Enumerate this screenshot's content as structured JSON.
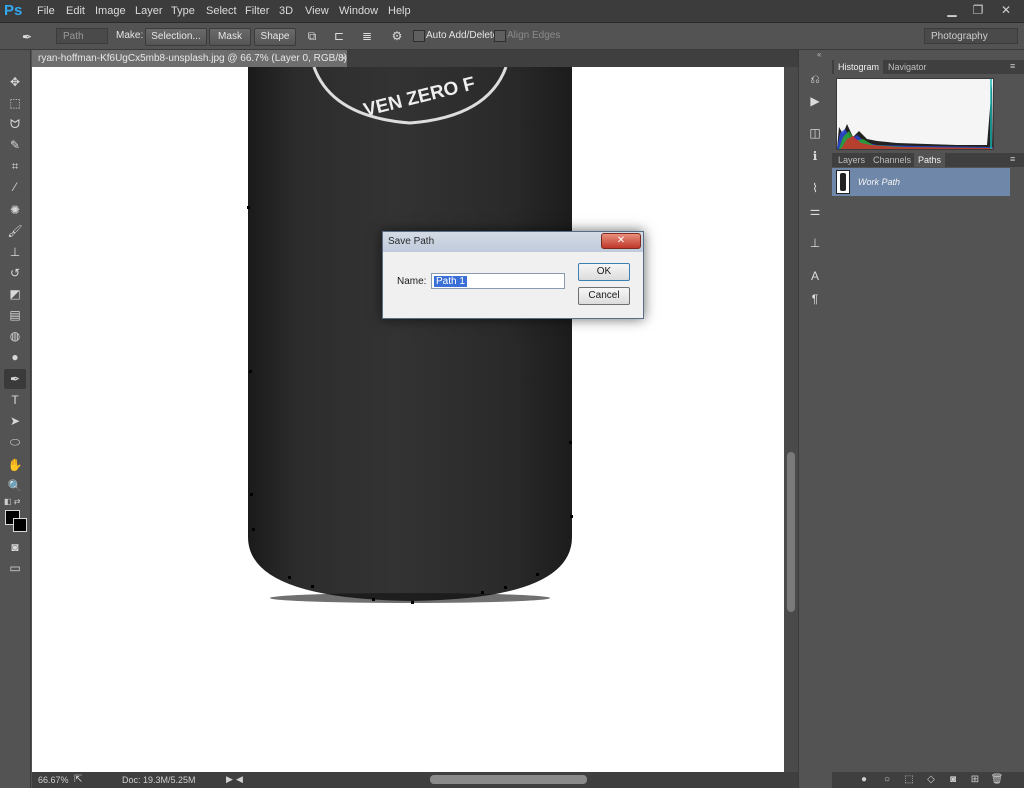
{
  "app": {
    "logo": "Ps"
  },
  "menu": [
    "File",
    "Edit",
    "Image",
    "Layer",
    "Type",
    "Select",
    "Filter",
    "3D",
    "View",
    "Window",
    "Help"
  ],
  "options": {
    "mode_select": "Path",
    "make_label": "Make:",
    "selection_btn": "Selection...",
    "mask_btn": "Mask",
    "shape_btn": "Shape",
    "auto_add_delete": "Auto Add/Delete",
    "align_edges": "Align Edges",
    "workspace": "Photography"
  },
  "document": {
    "tab_title": "ryan-hoffman-Kf6UgCx5mb8-unsplash.jpg @ 66.7% (Layer 0, RGB/8) *",
    "zoom": "66.67%",
    "doc_size": "Doc: 19.3M/5.25M",
    "bottle_text": "VEN ZERO F"
  },
  "dialog": {
    "title": "Save Path",
    "name_label": "Name:",
    "name_value": "Path 1",
    "ok": "OK",
    "cancel": "Cancel"
  },
  "panels": {
    "top_tabs": [
      "Histogram",
      "Navigator"
    ],
    "bottom_tabs": [
      "Layers",
      "Channels",
      "Paths"
    ],
    "path_item": "Work Path"
  },
  "colors": {
    "accent": "#32a8f0",
    "selection": "#3a6fd8",
    "path_row": "#6f87a8"
  }
}
